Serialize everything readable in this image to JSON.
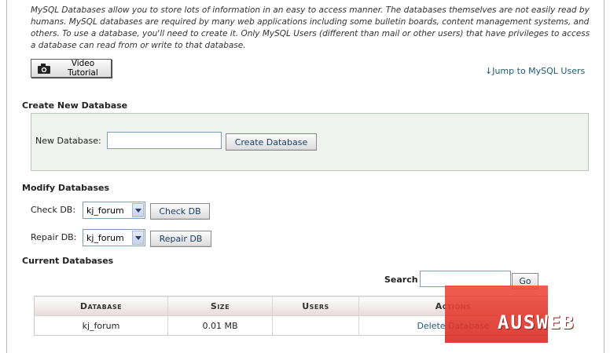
{
  "intro_text": "MySQL Databases allow you to store lots of information in an easy to access manner. The databases themselves are not easily read by humans. MySQL databases are required by many web applications including some bulletin boards, content management systems, and others. To use a database, you'll need to create it. Only MySQL Users (different than mail or other users) that have privileges to access a database can read from or write to that database.",
  "video_button": {
    "label": "Video Tutorial",
    "icon": "camera-icon"
  },
  "jump_link": "↓Jump to MySQL Users",
  "create_section": {
    "title": "Create New Database",
    "field_label": "New Database:",
    "field_value": "",
    "button_label": "Create Database"
  },
  "modify_section": {
    "title": "Modify Databases",
    "check": {
      "label": "Check DB:",
      "selected": "kj_forum",
      "button_label": "Check DB"
    },
    "repair": {
      "label": "Repair DB:",
      "selected": "kj_forum",
      "button_label": "Repair DB"
    }
  },
  "current_section": {
    "title": "Current Databases",
    "search_label": "Search",
    "search_value": "",
    "go_label": "Go",
    "columns": [
      "Database",
      "Size",
      "Users",
      "Actions"
    ],
    "rows": [
      {
        "database": "kj_forum",
        "size": "0.01 MB",
        "users": "",
        "action": "Delete Database"
      }
    ]
  },
  "watermark": "AUSWEB",
  "colors": {
    "link": "#1f5a72",
    "box_bg": "#eef3ee",
    "watermark": "#e23a30"
  }
}
